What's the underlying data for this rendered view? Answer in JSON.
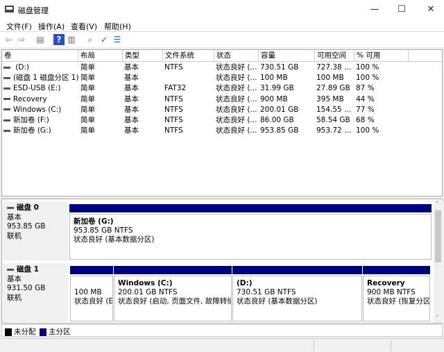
{
  "window": {
    "title": "磁盘管理",
    "minimize": "—",
    "maximize": "☐",
    "close": "✕"
  },
  "menu": [
    "文件(F)",
    "操作(A)",
    "查看(V)",
    "帮助(H)"
  ],
  "toolbar": [
    {
      "icon": "back-icon",
      "glyph": "⇦"
    },
    {
      "icon": "forward-icon",
      "glyph": "⇨"
    },
    {
      "icon": "console-tree-icon",
      "glyph": "▤"
    },
    {
      "icon": "help-icon",
      "glyph": "?"
    },
    {
      "icon": "action-pane-icon",
      "glyph": "▥"
    },
    {
      "icon": "connect-icon",
      "glyph": "⌕"
    },
    {
      "icon": "check-icon",
      "glyph": "✓"
    },
    {
      "icon": "properties-icon",
      "glyph": "☰"
    }
  ],
  "table": {
    "columns": [
      "卷",
      "布局",
      "类型",
      "文件系统",
      "状态",
      "容量",
      "可用空间",
      "% 可用"
    ],
    "rows": [
      [
        " (D:)",
        "简单",
        "基本",
        "NTFS",
        "状态良好 (...",
        "730.51 GB",
        "727.38 ...",
        "100 %"
      ],
      [
        "(磁盘 1 磁盘分区 1)",
        "简单",
        "基本",
        "",
        "状态良好 (...",
        "100 MB",
        "100 MB",
        "100 %"
      ],
      [
        "ESD-USB (E:)",
        "简单",
        "基本",
        "FAT32",
        "状态良好 (...",
        "31.99 GB",
        "27.89 GB",
        "87 %"
      ],
      [
        "Recovery",
        "简单",
        "基本",
        "NTFS",
        "状态良好 (...",
        "900 MB",
        "395 MB",
        "44 %"
      ],
      [
        "Windows (C:)",
        "简单",
        "基本",
        "NTFS",
        "状态良好 (...",
        "200.01 GB",
        "154.55 ...",
        "77 %"
      ],
      [
        "新加卷 (F:)",
        "简单",
        "基本",
        "NTFS",
        "状态良好 (...",
        "86.00 GB",
        "58.54 GB",
        "68 %"
      ],
      [
        "新加卷 (G:)",
        "简单",
        "基本",
        "NTFS",
        "状态良好 (...",
        "953.85 GB",
        "953.72 ...",
        "100 %"
      ]
    ]
  },
  "disks": [
    {
      "name": "磁盘 0",
      "type": "基本",
      "size": "953.85 GB",
      "state": "联机",
      "partitions": [
        {
          "label": "新加卷  (G:)",
          "size": "953.85 GB NTFS",
          "status": "状态良好 (基本数据分区)"
        }
      ]
    },
    {
      "name": "磁盘 1",
      "type": "基本",
      "size": "931.50 GB",
      "state": "联机",
      "partitions": [
        {
          "label": "",
          "size": "100 MB",
          "status": "状态良好 (EFI 系统分区)"
        },
        {
          "label": "Windows  (C:)",
          "size": "200.01 GB NTFS",
          "status": "状态良好 (启动, 页面文件, 故障转储, 基本数据分区)"
        },
        {
          "label": " (D:)",
          "size": "730.51 GB NTFS",
          "status": "状态良好 (基本数据分区)"
        },
        {
          "label": "Recovery",
          "size": "900 MB NTFS",
          "status": "状态良好 (恢复分区)"
        }
      ]
    }
  ],
  "legend": [
    {
      "label": "未分配",
      "color": "#000000"
    },
    {
      "label": "主分区",
      "color": "#00007f"
    }
  ],
  "colors": {
    "primary_partition": "#00007f"
  }
}
